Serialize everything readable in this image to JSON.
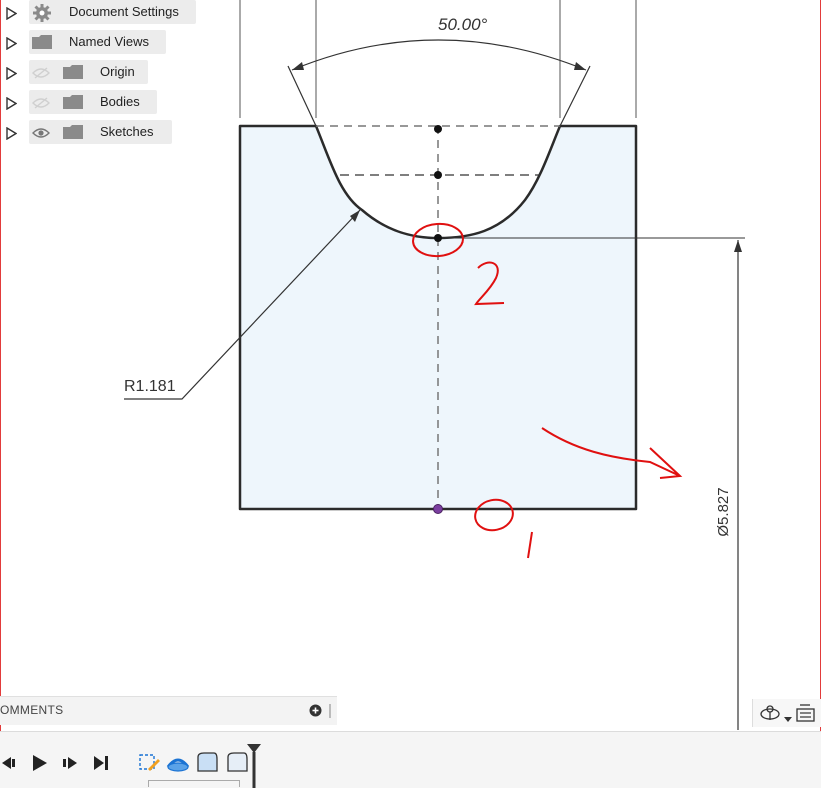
{
  "browser": {
    "items": [
      {
        "label": "Document Settings",
        "icon": "gear-icon"
      },
      {
        "label": "Named Views",
        "icon": "folder-icon"
      },
      {
        "label": "Origin",
        "icon": "folder-icon",
        "visibility": "hidden-eye-icon"
      },
      {
        "label": "Bodies",
        "icon": "folder-icon",
        "visibility": "hidden-eye-icon"
      },
      {
        "label": "Sketches",
        "icon": "folder-icon",
        "visibility": "eye-icon"
      }
    ]
  },
  "drawing": {
    "angle_dimension": "50.00°",
    "radius_dimension": "R1.181",
    "diameter_dimension": "Ø5.827",
    "annotation_top": "2",
    "annotation_bottom": "1"
  },
  "comments": {
    "label": "OMMENTS"
  },
  "colors": {
    "part_fill": "#eef6fc",
    "annotation_red": "#e01010",
    "frame_red": "#e23b3b",
    "origin_point": "#7b3fa0"
  }
}
